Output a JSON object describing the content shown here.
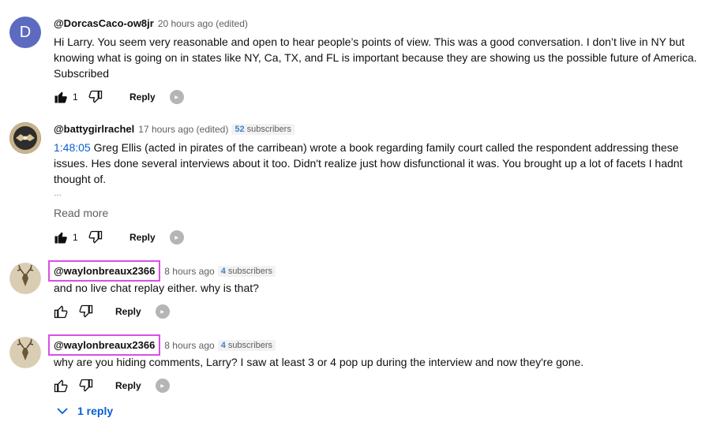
{
  "comments": [
    {
      "avatar_letter": "D",
      "author": "@DorcasCaco-ow8jr",
      "meta": "20 hours ago (edited)",
      "text": "Hi Larry. You seem very reasonable and open to hear people’s points of view. This was a good conversation. I don’t live in NY but knowing what is going on in states like NY, Ca, TX, and FL is important because they are showing us the possible future of America. Subscribed",
      "likes": "1",
      "reply_label": "Reply"
    },
    {
      "author": "@battygirlrachel",
      "meta": "17 hours ago (edited)",
      "subs_count": "52",
      "subs_label": "subscribers",
      "timestamp_link": "1:48:05",
      "text": " Greg Ellis (acted in pirates of the carribean) wrote a book regarding family court called the respondent addressing these issues. Hes done several interviews about it too. Didn't realize just how disfunctional it was. You brought up a lot of facets I hadnt thought of.",
      "ellipsis": "…",
      "read_more": "Read more",
      "likes": "1",
      "reply_label": "Reply"
    },
    {
      "author": "@waylonbreaux2366",
      "meta": "8 hours ago",
      "subs_count": "4",
      "subs_label": "subscribers",
      "text": "and no live chat replay either.  why is that?",
      "reply_label": "Reply"
    },
    {
      "author": "@waylonbreaux2366",
      "meta": "8 hours ago",
      "subs_count": "4",
      "subs_label": "subscribers",
      "text": "why are you hiding comments, Larry? I saw at least 3 or 4 pop up during the interview and now they're gone.",
      "reply_label": "Reply",
      "replies_label": "1 reply"
    }
  ],
  "colors": {
    "highlight_box": "#d94fe6",
    "link": "#065fd4",
    "avatar_d": "#5c6bc0"
  },
  "icons": [
    "like-icon",
    "dislike-icon",
    "creator-heart-icon",
    "chevron-down-icon"
  ]
}
